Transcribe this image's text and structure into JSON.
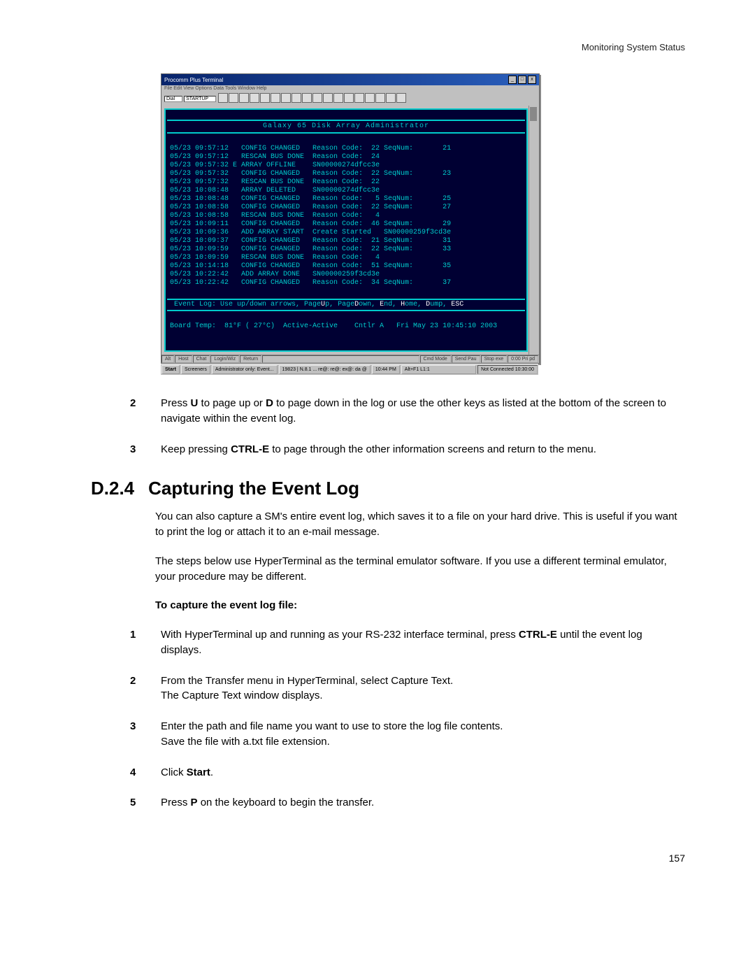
{
  "header": {
    "running": "Monitoring System Status"
  },
  "window": {
    "title": "Procomm Plus Terminal",
    "menu": "File  Edit  View  Options  Data  Tools  Window  Help",
    "combo1": "Dial",
    "combo2": "STARTUP"
  },
  "terminal": {
    "banner": "Galaxy 65 Disk Array Administrator",
    "log": "05/23 09:57:12   CONFIG CHANGED   Reason Code:  22 SeqNum:       21\n05/23 09:57:12   RESCAN BUS DONE  Reason Code:  24\n05/23 09:57:32 E ARRAY OFFLINE    SN00000274dfcc3e\n05/23 09:57:32   CONFIG CHANGED   Reason Code:  22 SeqNum:       23\n05/23 09:57:32   RESCAN BUS DONE  Reason Code:  22\n05/23 10:08:48   ARRAY DELETED    SN00000274dfcc3e\n05/23 10:08:48   CONFIG CHANGED   Reason Code:   5 SeqNum:       25\n05/23 10:08:58   CONFIG CHANGED   Reason Code:  22 SeqNum:       27\n05/23 10:08:58   RESCAN BUS DONE  Reason Code:   4\n05/23 10:09:11   CONFIG CHANGED   Reason Code:  46 SeqNum:       29\n05/23 10:09:36   ADD ARRAY START  Create Started   SN00000259f3cd3e\n05/23 10:09:37   CONFIG CHANGED   Reason Code:  21 SeqNum:       31\n05/23 10:09:59   CONFIG CHANGED   Reason Code:  22 SeqNum:       33\n05/23 10:09:59   RESCAN BUS DONE  Reason Code:   4\n05/23 10:14:18   CONFIG CHANGED   Reason Code:  51 SeqNum:       35\n05/23 10:22:42   ADD ARRAY DONE   SN00000259f3cd3e\n05/23 10:22:42   CONFIG CHANGED   Reason Code:  34 SeqNum:       37",
    "hint_pre": " Event Log: Use up/down arrows, Page",
    "hint_u": "U",
    "hint_mid1": "p, Page",
    "hint_d": "D",
    "hint_mid2": "own, ",
    "hint_e": "E",
    "hint_mid3": "nd, ",
    "hint_h": "H",
    "hint_mid4": "ome, ",
    "hint_dm": "D",
    "hint_mid5": "ump, ",
    "hint_esc": "ESC",
    "status": "Board Temp:  81°F ( 27°C)  Active-Active    Cntlr A   Fri May 23 10:45:10 2003"
  },
  "status_cells": {
    "c1": "Alt",
    "c2": "Host",
    "c3": "Chat",
    "c4": "Login/Wiz",
    "c5": "Return",
    "c6": "Cmd Mode",
    "c7": "Send Pau",
    "c8": "Stop exe",
    "c9": "0:00 Pri pd"
  },
  "taskbar": {
    "start": "Start",
    "b1": "Screeners",
    "b2": "Administrator only: Event...",
    "b3": "19823 | N.8.1 ... re@: re@: ex@: da @",
    "b4": "10:44 PM",
    "b5": "Alt+F1  L1:1",
    "tray": "Not Connected   10:30:00"
  },
  "steps_top": {
    "s2": {
      "n": "2",
      "pre": "Press ",
      "k1": "U",
      "mid1": " to page up or ",
      "k2": "D",
      "post": " to page down in the log or use the other keys as listed at the bottom of the screen to navigate within the event log."
    },
    "s3": {
      "n": "3",
      "pre": "Keep pressing ",
      "k1": "CTRL-E",
      "post": " to page through the other information screens and return to the menu."
    }
  },
  "section": {
    "no": "D.2.4",
    "title": "Capturing the Event Log"
  },
  "body": {
    "p1": "You can also capture a SM's entire event log, which saves it to a file on your hard drive. This is useful if you want to print the log or attach it to an e-mail message.",
    "p2": "The steps below use HyperTerminal as the terminal emulator software. If you use a different terminal emulator, your procedure may be different.",
    "subhead": "To capture the event log file:"
  },
  "steps": {
    "s1": {
      "n": "1",
      "pre": "With HyperTerminal up and running as your RS-232 interface terminal, press ",
      "k1": "CTRL-E",
      "post": " until the event log displays."
    },
    "s2": {
      "n": "2",
      "t": "From the Transfer menu in HyperTerminal, select Capture Text.\nThe Capture Text window displays."
    },
    "s3": {
      "n": "3",
      "t": "Enter the path and file name you want to use to store the log file contents.\nSave the file with a.txt file extension."
    },
    "s4": {
      "n": "4",
      "pre": "Click ",
      "k1": "Start",
      "post": "."
    },
    "s5": {
      "n": "5",
      "pre": "Press ",
      "k1": "P",
      "post": " on the keyboard to begin the transfer."
    }
  },
  "page_number": "157"
}
